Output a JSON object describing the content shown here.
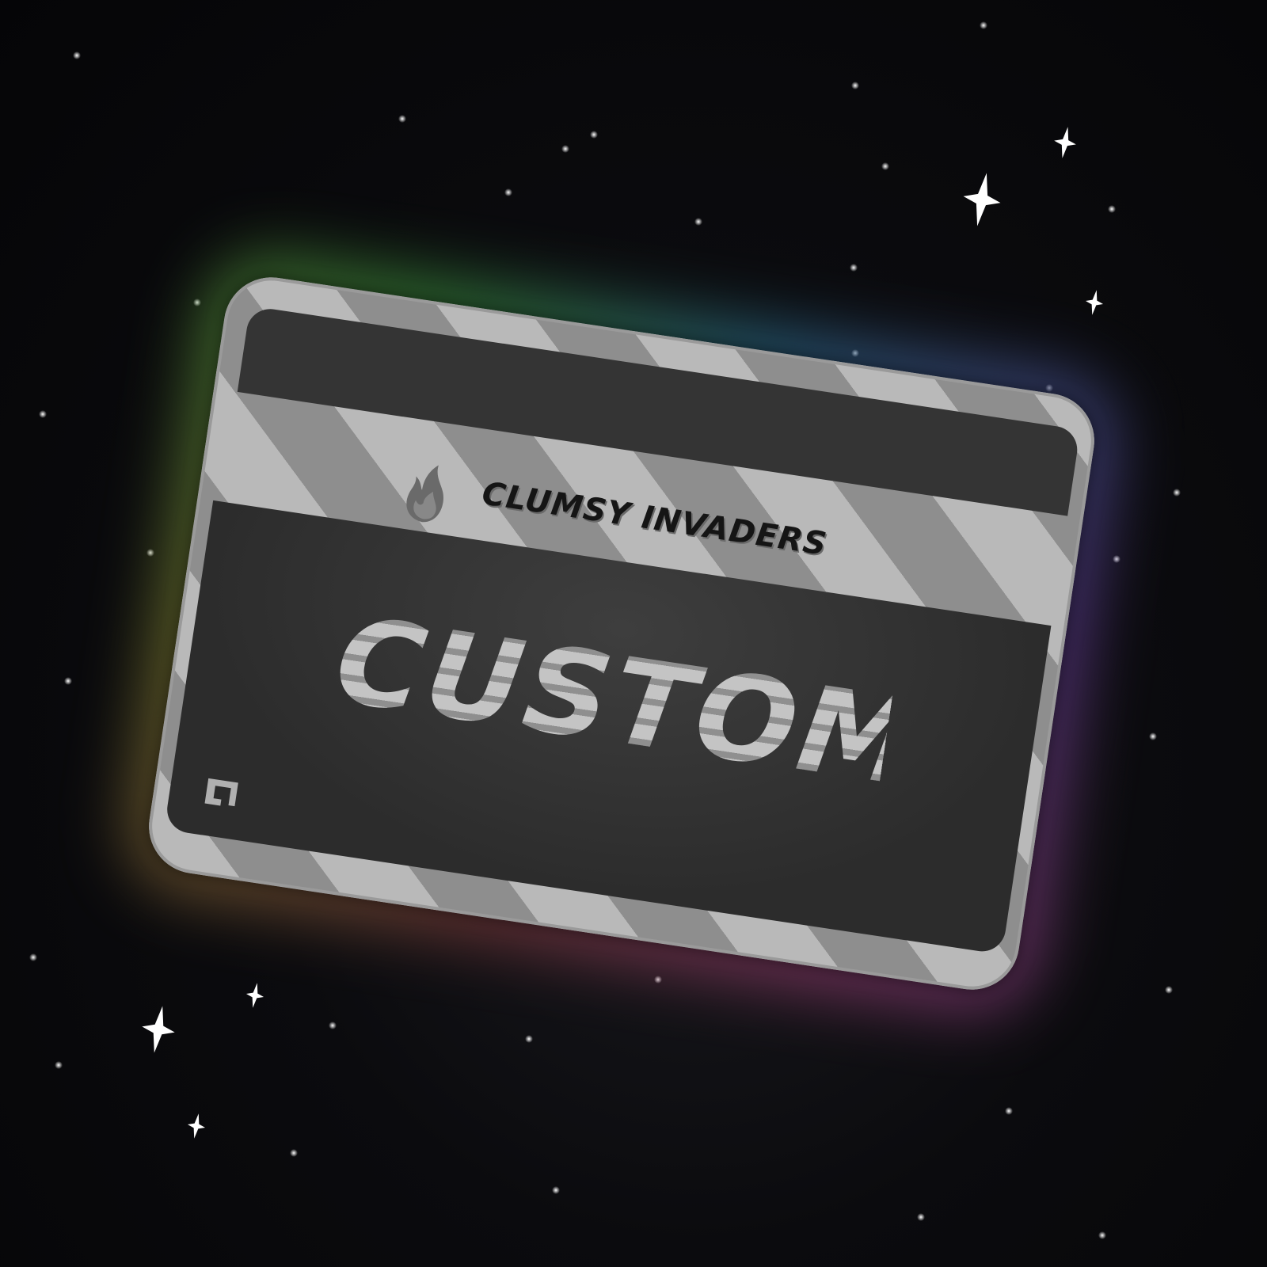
{
  "card": {
    "brand_text": "CLUMSY INVADERS",
    "title_text": "CUSTOM",
    "logo_icon": "flame-icon",
    "corner_icon": "brand-monogram-icon"
  },
  "colors": {
    "background": "#0b0b0e",
    "card_light_stripe": "#b9b9b9",
    "card_dark_stripe": "#8e8e8e",
    "panel": "#343434",
    "brand_text": "#151515",
    "title_text": "#b5b5b5",
    "star": "#ffffff"
  }
}
